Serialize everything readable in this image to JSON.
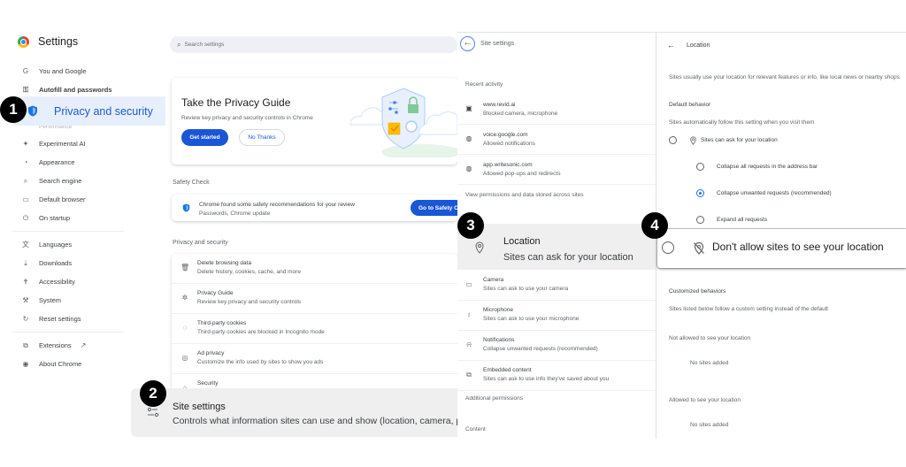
{
  "sidebar": {
    "title": "Settings",
    "items": [
      {
        "icon": "google-g-icon",
        "glyph": "G",
        "label": "You and Google"
      },
      {
        "icon": "key-icon",
        "glyph": "⚿",
        "label": "Autofill and passwords"
      },
      {
        "icon": "performance-icon",
        "glyph": "▭",
        "label": "Performance"
      },
      {
        "icon": "sparkle-icon",
        "glyph": "✦",
        "label": "Experimental AI"
      },
      {
        "icon": "palette-icon",
        "glyph": "◔",
        "label": "Appearance"
      },
      {
        "icon": "search-icon",
        "glyph": "⌕",
        "label": "Search engine"
      },
      {
        "icon": "browser-window-icon",
        "glyph": "▭",
        "label": "Default browser"
      },
      {
        "icon": "power-icon",
        "glyph": "⏻",
        "label": "On startup"
      },
      {
        "icon": "translate-icon",
        "glyph": "文",
        "label": "Languages"
      },
      {
        "icon": "download-icon",
        "glyph": "⤓",
        "label": "Downloads"
      },
      {
        "icon": "accessibility-icon",
        "glyph": "✝",
        "label": "Accessibility"
      },
      {
        "icon": "wrench-icon",
        "glyph": "⚒",
        "label": "System"
      },
      {
        "icon": "reset-icon",
        "glyph": "↻",
        "label": "Reset settings"
      },
      {
        "icon": "extensions-icon",
        "glyph": "⧉",
        "label": "Extensions"
      },
      {
        "icon": "chrome-icon",
        "glyph": "◉",
        "label": "About Chrome"
      }
    ],
    "active_item": "Privacy and security",
    "external_link_glyph": "↗"
  },
  "main": {
    "search_placeholder": "Search settings",
    "privacy_guide": {
      "title": "Take the Privacy Guide",
      "description": "Review key privacy and security controls in Chrome",
      "primary_button": "Get started",
      "secondary_button": "No Thanks"
    },
    "safety_check": {
      "section_label": "Safety Check",
      "line1": "Chrome found some safety recommendations for your review",
      "line2": "Passwords, Chrome update",
      "button": "Go to Safety Check"
    },
    "privacy_section_label": "Privacy and security",
    "privacy_rows": [
      {
        "icon": "trash-icon",
        "glyph": "🗑",
        "title": "Delete browsing data",
        "subtitle": "Delete history, cookies, cache, and more"
      },
      {
        "icon": "privacy-guide-icon",
        "glyph": "✲",
        "title": "Privacy Guide",
        "subtitle": "Review key privacy and security controls"
      },
      {
        "icon": "cookie-icon",
        "glyph": "◌",
        "title": "Third-party cookies",
        "subtitle": "Third-party cookies are blocked in Incognito mode"
      },
      {
        "icon": "ad-privacy-icon",
        "glyph": "◎",
        "title": "Ad privacy",
        "subtitle": "Customize the info used by sites to show you ads"
      },
      {
        "icon": "lock-icon",
        "glyph": "⌂",
        "title": "Security",
        "subtitle": ""
      }
    ],
    "site_settings_callout": {
      "title": "Site settings",
      "subtitle": "Controls what information sites can use and show (location, camera, pop-ups, and more)"
    }
  },
  "site_settings": {
    "title": "Site settings",
    "recent_label": "Recent activity",
    "recent": [
      {
        "icon": "blocked-site-icon",
        "glyph": "▣",
        "site": "www.revid.ai",
        "detail": "Blocked camera, microphone"
      },
      {
        "icon": "globe-icon",
        "glyph": "◍",
        "site": "voice.google.com",
        "detail": "Allowed notifications"
      },
      {
        "icon": "globe-icon",
        "glyph": "◍",
        "site": "app.writesonic.com",
        "detail": "Allowed pop-ups and redirects"
      }
    ],
    "view_permissions": "View permissions and data stored across sites",
    "location_callout": {
      "title": "Location",
      "subtitle": "Sites can ask for your location"
    },
    "permissions": [
      {
        "icon": "camera-icon",
        "glyph": "▭",
        "title": "Camera",
        "subtitle": "Sites can ask to use your camera"
      },
      {
        "icon": "microphone-icon",
        "glyph": "🎙",
        "title": "Microphone",
        "subtitle": "Sites can ask to use your microphone"
      },
      {
        "icon": "bell-icon",
        "glyph": "🔔",
        "title": "Notifications",
        "subtitle": "Collapse unwanted requests (recommended)"
      },
      {
        "icon": "embedded-content-icon",
        "glyph": "⧉",
        "title": "Embedded content",
        "subtitle": "Sites can ask to use info they've saved about you"
      }
    ],
    "additional_permissions": "Additional permissions",
    "content_label": "Content"
  },
  "location": {
    "title": "Location",
    "description": "Sites usually use your location for relevant features or info, like local news or nearby shops",
    "default_behavior_label": "Default behavior",
    "default_behavior_desc": "Sites automatically follow this setting when you visit them",
    "ask_option": "Sites can ask for your location",
    "sub_options": [
      {
        "label": "Collapse all requests in the address bar",
        "selected": false
      },
      {
        "label": "Collapse unwanted requests (recommended)",
        "selected": true
      },
      {
        "label": "Expand all requests",
        "selected": false
      }
    ],
    "deny_option": "Don't allow sites to see your location",
    "customized_label": "Customized behaviors",
    "customized_desc": "Sites listed below follow a custom setting instead of the default",
    "not_allowed_label": "Not allowed to see your location",
    "not_allowed_empty": "No sites added",
    "allowed_label": "Allowed to see your location",
    "allowed_empty": "No sites added"
  },
  "steps": [
    "1",
    "2",
    "3",
    "4"
  ],
  "colors": {
    "accent": "#1a56d6",
    "highlight": "#e8effc",
    "callout_bg": "#efefef",
    "badge": "#000000"
  }
}
